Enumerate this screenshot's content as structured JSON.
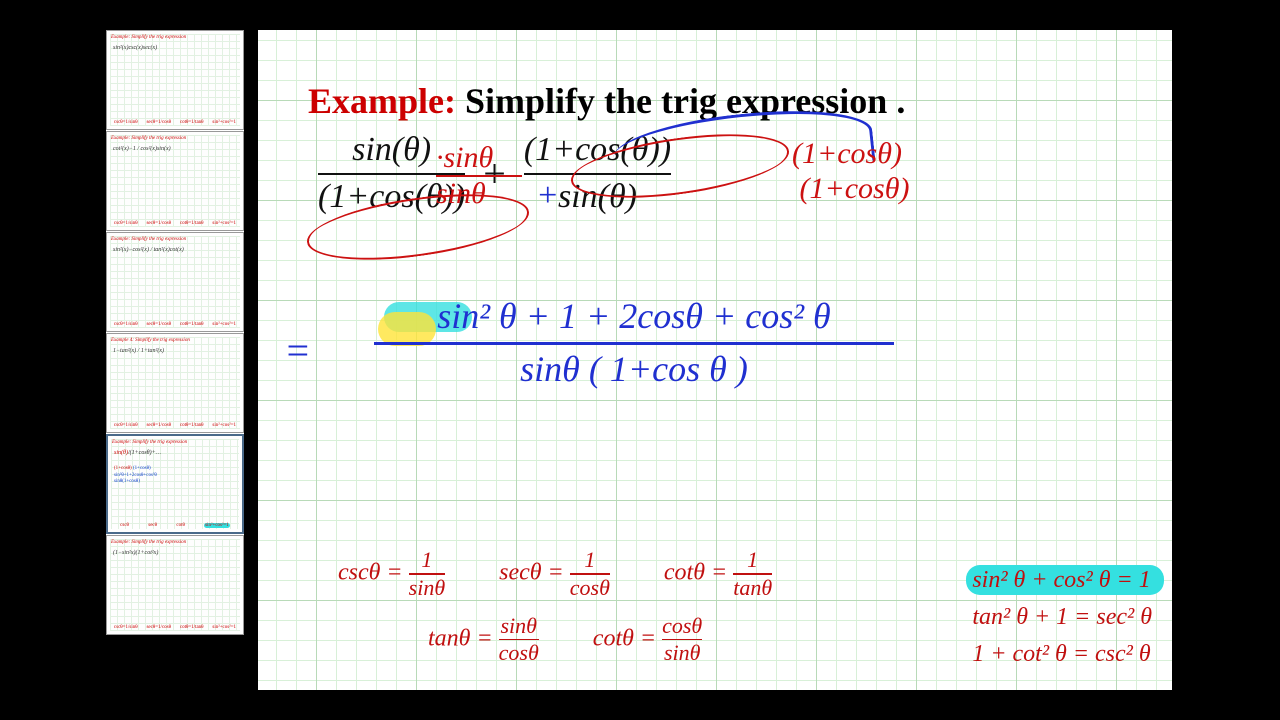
{
  "heading": {
    "example_label": "Example:",
    "title": "Simplify the trig expression"
  },
  "problem": {
    "term1": {
      "num": "sin(θ)",
      "den": "(1+cos(θ))"
    },
    "op": "+",
    "term2": {
      "num": "(1+cos(θ))",
      "den": "sin(θ)"
    }
  },
  "hand": {
    "mult1_num": "·sinθ",
    "mult1_den": "sinθ",
    "mult2_top": "(1+cosθ)",
    "mult2_bot": "(1+cosθ)",
    "eq": "=",
    "step_num": "sin² θ  + 1 + 2cosθ + cos² θ",
    "step_den": "sinθ ( 1+cos θ )"
  },
  "identities": {
    "row1": [
      {
        "lhs": "cscθ =",
        "num": "1",
        "den": "sinθ"
      },
      {
        "lhs": "secθ =",
        "num": "1",
        "den": "cosθ"
      },
      {
        "lhs": "cotθ =",
        "num": "1",
        "den": "tanθ"
      }
    ],
    "row2": [
      {
        "lhs": "tanθ =",
        "num": "sinθ",
        "den": "cosθ"
      },
      {
        "lhs": "cotθ =",
        "num": "cosθ",
        "den": "sinθ"
      }
    ],
    "pyth": [
      "sin² θ + cos² θ = 1",
      "tan² θ + 1 = sec² θ",
      "1 + cot² θ = csc² θ"
    ]
  },
  "thumbnails": [
    {
      "title": "Example: Simplify the trig expression",
      "expr": "sin²(x)csc(x)sec(x)"
    },
    {
      "title": "Example: Simplify the trig expression",
      "expr": "cot²(x)−1 / cos²(x)sin(x)"
    },
    {
      "title": "Example: Simplify the trig expression",
      "expr": "sin²(x)−cos²(x) / tan²(x)cot(x)"
    },
    {
      "title": "Example 4: Simplify the trig expression",
      "expr": "1−tan²(x) / 1+tan²(x)"
    },
    {
      "title": "Example: Simplify the trig expression",
      "expr": "sin(θ)/(1+cos(θ)) + (1+cos(θ))/sin(θ)",
      "selected": true
    },
    {
      "title": "Example: Simplify the trig expression",
      "expr": "(1−sin²x)(1+cot²x)"
    }
  ],
  "thumb_work": {
    "line1": "sin²θ+1+2cosθ+cos²θ",
    "line2": "sinθ(1+cosθ)"
  }
}
